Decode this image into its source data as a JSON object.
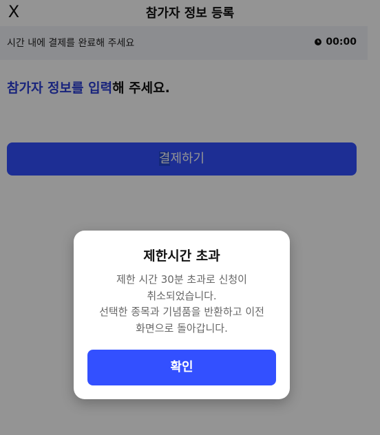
{
  "header": {
    "close_label": "X",
    "title": "참가자 정보 등록"
  },
  "timer": {
    "message": "시간 내에 결제를 완료해 주세요",
    "time": "00:00",
    "icon": "clock-icon"
  },
  "intro": {
    "highlight": "참가자 정보를 입력",
    "rest": "해 주세요."
  },
  "pay_button": {
    "label_first": "결",
    "label_rest": "제하기"
  },
  "dialog": {
    "title": "제한시간 초과",
    "lines": [
      "제한 시간 30분 초과로 신청이",
      "취소되었습니다.",
      "선택한 종목과 기념품을 반환하고 이전",
      "화면으로 돌아갑니다."
    ],
    "confirm_label": "확인"
  },
  "colors": {
    "accent": "#3350ff",
    "highlight_text": "#2c3fd6",
    "timer_bar_bg": "#f1f3f9"
  }
}
